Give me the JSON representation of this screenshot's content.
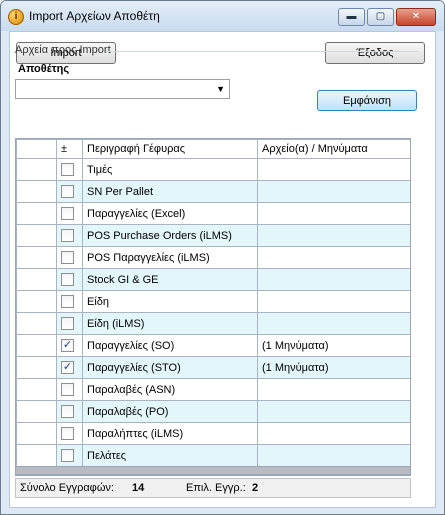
{
  "window": {
    "title": "Import Αρχείων Αποθέτη",
    "app_icon_glyph": "i",
    "minimize_glyph": "▬",
    "maximize_glyph": "▢",
    "close_glyph": "✕"
  },
  "toolbar": {
    "import_label": "Import",
    "exit_label": "Έξοδος"
  },
  "group": {
    "label": "Αρχεία προς Import"
  },
  "depositor": {
    "label": "Αποθέτης",
    "value": "",
    "arrow_glyph": "▼"
  },
  "show_button": {
    "label": "Εμφάνιση"
  },
  "grid": {
    "columns": [
      "±",
      "Περιγραφή Γέφυρας",
      "Αρχείο(α) / Μηνύματα"
    ],
    "check_glyph": "✓",
    "rows": [
      {
        "checked": false,
        "description": "Τιμές",
        "files": ""
      },
      {
        "checked": false,
        "description": "SN Per Pallet",
        "files": ""
      },
      {
        "checked": false,
        "description": "Παραγγελίες (Excel)",
        "files": ""
      },
      {
        "checked": false,
        "description": "POS Purchase Orders (iLMS)",
        "files": ""
      },
      {
        "checked": false,
        "description": "POS Παραγγελίες (iLMS)",
        "files": ""
      },
      {
        "checked": false,
        "description": "Stock GI & GE",
        "files": ""
      },
      {
        "checked": false,
        "description": "Είδη",
        "files": ""
      },
      {
        "checked": false,
        "description": "Είδη (iLMS)",
        "files": ""
      },
      {
        "checked": true,
        "description": "Παραγγελίες (SO)",
        "files": "(1 Μηνύματα)"
      },
      {
        "checked": true,
        "description": "Παραγγελίες (STO)",
        "files": "(1 Μηνύματα)"
      },
      {
        "checked": false,
        "description": "Παραλαβές (ASN)",
        "files": ""
      },
      {
        "checked": false,
        "description": "Παραλαβές (PO)",
        "files": ""
      },
      {
        "checked": false,
        "description": "Παραλήπτες (iLMS)",
        "files": ""
      },
      {
        "checked": false,
        "description": "Πελάτες",
        "files": ""
      }
    ]
  },
  "status": {
    "total_label": "Σύνολο Εγγραφών:",
    "total_value": "14",
    "selected_label": "Επιλ. Εγγρ.:",
    "selected_value": "2"
  },
  "colors": {
    "alt_row": "#e3f7fb",
    "window_frame": "#dfe9f5",
    "check_mark": "#1a3f84"
  }
}
